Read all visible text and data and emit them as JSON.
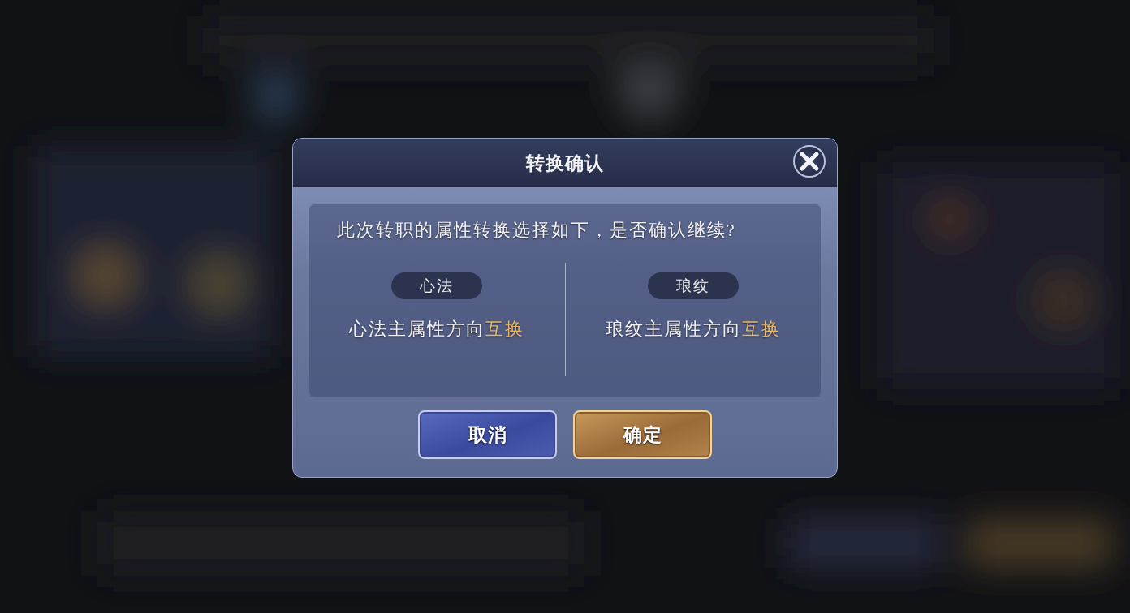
{
  "dialog": {
    "title": "转换确认",
    "question": "此次转职的属性转换选择如下，是否确认继续?",
    "options": [
      {
        "tag": "心法",
        "text": "心法主属性方向",
        "highlight": "互换"
      },
      {
        "tag": "琅纹",
        "text": "琅纹主属性方向",
        "highlight": "互换"
      }
    ],
    "buttons": [
      {
        "label": "取消",
        "kind": "cancel"
      },
      {
        "label": "确定",
        "kind": "confirm"
      }
    ]
  }
}
